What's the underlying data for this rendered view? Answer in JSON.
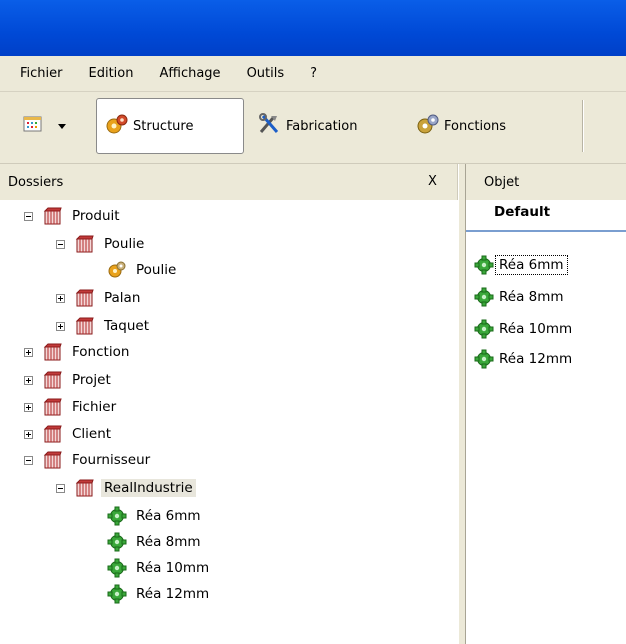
{
  "menu": {
    "items": [
      "Fichier",
      "Edition",
      "Affichage",
      "Outils",
      "?"
    ]
  },
  "toolbar": {
    "structure_label": "Structure",
    "fabrication_label": "Fabrication",
    "fonctions_label": "Fonctions",
    "icons": [
      "calendar-icon",
      "gears-icon",
      "tools-icon",
      "gears-icon"
    ]
  },
  "left_panel": {
    "title": "Dossiers",
    "close": "X"
  },
  "right_panel": {
    "title": "Objet",
    "tab": "Default",
    "items": [
      "Réa 6mm",
      "Réa 8mm",
      "Réa 10mm",
      "Réa 12mm"
    ]
  },
  "tree": {
    "produit": "Produit",
    "poulie_folder": "Poulie",
    "poulie_item": "Poulie",
    "palan": "Palan",
    "taquet": "Taquet",
    "fonction": "Fonction",
    "projet": "Projet",
    "fichier": "Fichier",
    "client": "Client",
    "fournisseur": "Fournisseur",
    "realindustrie": "RealIndustrie",
    "parts": [
      "Réa 6mm",
      "Réa 8mm",
      "Réa 10mm",
      "Réa 12mm"
    ]
  },
  "colors": {
    "titlebar": "#0a5ee8",
    "chrome": "#ece9d8",
    "part_icon": "#2e9a2e",
    "folder_icon": "#b22a2a"
  }
}
